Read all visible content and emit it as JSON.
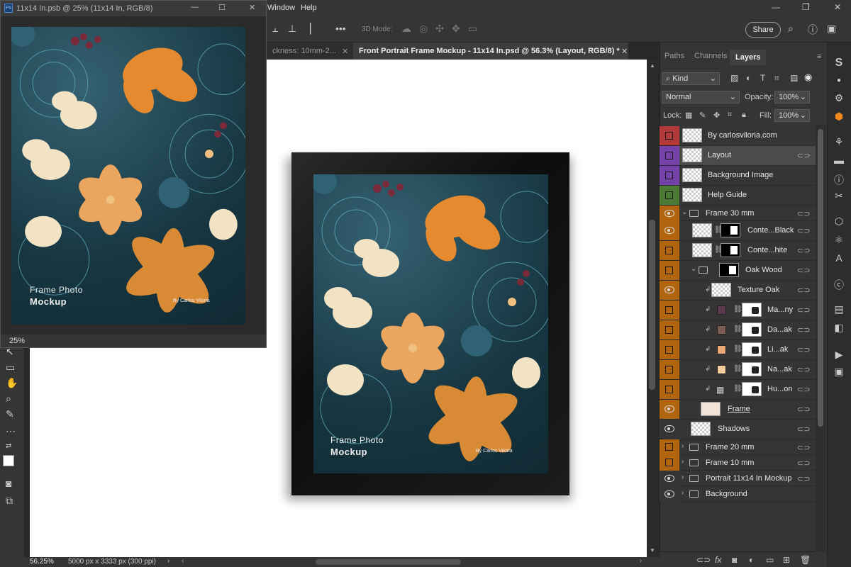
{
  "menubar": {
    "items": [
      "Window",
      "Help"
    ]
  },
  "options": {
    "threed_label": "3D Mode:",
    "share_label": "Share"
  },
  "tabs": [
    {
      "label": "ckness: 10mm-2..."
    },
    {
      "label": "Front Portrait Frame Mockup - 11x14 In.psd @ 56.3% (Layout, RGB/8) *"
    }
  ],
  "floatwin": {
    "title": "11x14 In.psb @ 25% (11x14 In, RGB/8)",
    "zoom": "25%"
  },
  "artwork": {
    "title_line1": "Frame Photo",
    "title_line2": "Mockup",
    "credit": "By Carlos Viloria"
  },
  "status": {
    "zoom": "56.25%",
    "info": "5000 px x 3333 px (300 ppi)"
  },
  "panel": {
    "tabs": [
      "Paths",
      "Channels",
      "Layers"
    ],
    "filter": "Kind",
    "blend": "Normal",
    "opacity_label": "Opacity:",
    "opacity": "100%",
    "lock_label": "Lock:",
    "fill_label": "Fill:",
    "fill": "100%"
  },
  "layers": [
    {
      "name": "By carlosviloria.com",
      "color": "#b03a3a",
      "visible": false
    },
    {
      "name": "Layout",
      "color": "#7442a8",
      "visible": false
    },
    {
      "name": "Background Image",
      "color": "#7442a8",
      "visible": false
    },
    {
      "name": "Help Guide",
      "color": "#4d7a35",
      "visible": false
    },
    {
      "name": "Frame 30 mm",
      "color": "#b0650e",
      "visible": true
    },
    {
      "name": "Conte...Black",
      "color": "#b0650e",
      "visible": true
    },
    {
      "name": "Conte...hite",
      "color": "#b0650e",
      "visible": false
    },
    {
      "name": "Oak Wood",
      "color": "#b0650e",
      "visible": false
    },
    {
      "name": "Texture Oak",
      "color": "#b0650e",
      "visible": true
    },
    {
      "name": "Ma...ny",
      "color": "#b0650e",
      "visible": false,
      "swatch": "#5a3a4c"
    },
    {
      "name": "Da...ak",
      "color": "#b0650e",
      "visible": false,
      "swatch": "#7a5c55"
    },
    {
      "name": "Li...ak",
      "color": "#b0650e",
      "visible": false,
      "swatch": "#e8a878"
    },
    {
      "name": "Na...ak",
      "color": "#b0650e",
      "visible": false,
      "swatch": "#f5cc9c"
    },
    {
      "name": "Hu...on",
      "color": "#b0650e",
      "visible": false
    },
    {
      "name": "Frame",
      "color": "#b0650e",
      "visible": true
    },
    {
      "name": "Shadows",
      "color": "#353535",
      "visible": true
    },
    {
      "name": "Frame 20 mm",
      "color": "#b0650e",
      "visible": false
    },
    {
      "name": "Frame 10 mm",
      "color": "#b0650e",
      "visible": false
    },
    {
      "name": "Portrait 11x14 In Mockup",
      "color": "#353535",
      "visible": true
    },
    {
      "name": "Background",
      "color": "#353535",
      "visible": true
    }
  ],
  "icons": {
    "eye": "eye-icon",
    "folder": "folder-icon",
    "link": "link-icon",
    "chain": "chain-icon",
    "clip": "clipping-arrow-icon"
  }
}
